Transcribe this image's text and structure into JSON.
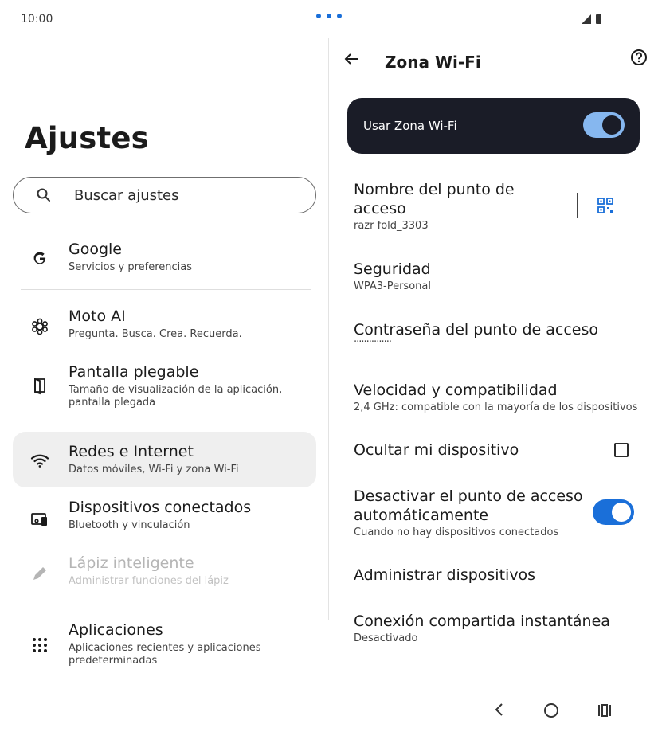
{
  "status_bar": {
    "time": "10:00"
  },
  "left": {
    "title": "Ajustes",
    "search_placeholder": "Buscar ajustes",
    "items": [
      {
        "title": "Google",
        "subtitle": "Servicios y preferencias"
      },
      {
        "title": "Moto AI",
        "subtitle": "Pregunta. Busca. Crea. Recuerda."
      },
      {
        "title": "Pantalla plegable",
        "subtitle": "Tamaño de visualización de la aplicación, pantalla plegada"
      },
      {
        "title": "Redes e Internet",
        "subtitle": "Datos móviles, Wi-Fi y zona Wi-Fi"
      },
      {
        "title": "Dispositivos conectados",
        "subtitle": "Bluetooth y vinculación"
      },
      {
        "title": "Lápiz inteligente",
        "subtitle": "Administrar funciones del lápiz"
      },
      {
        "title": "Aplicaciones",
        "subtitle": "Aplicaciones recientes y aplicaciones predeterminadas"
      }
    ]
  },
  "right": {
    "title": "Zona Wi-Fi",
    "main_switch_label": "Usar Zona Wi-Fi",
    "settings": {
      "name": {
        "title": "Nombre del punto de acceso",
        "subtitle": "razr fold_3303"
      },
      "security": {
        "title": "Seguridad",
        "subtitle": "WPA3-Personal"
      },
      "password": {
        "title": "Contraseña del punto de acceso",
        "subtitle": "···············"
      },
      "speed": {
        "title": "Velocidad y compatibilidad",
        "subtitle": "2,4 GHz: compatible con la mayoría de los dispositivos"
      },
      "hide": {
        "title": "Ocultar mi dispositivo"
      },
      "auto_off": {
        "title": "Desactivar el punto de acceso automáticamente",
        "subtitle": "Cuando no hay dispositivos conectados"
      },
      "manage": {
        "title": "Administrar dispositivos"
      },
      "instant": {
        "title": "Conexión compartida instantánea",
        "subtitle": "Desactivado"
      }
    }
  },
  "colors": {
    "main_card_bg": "#1a1c27",
    "main_toggle": "#86b7ef",
    "accent_toggle": "#1a6fd9",
    "selected_item_bg": "#efefef"
  }
}
